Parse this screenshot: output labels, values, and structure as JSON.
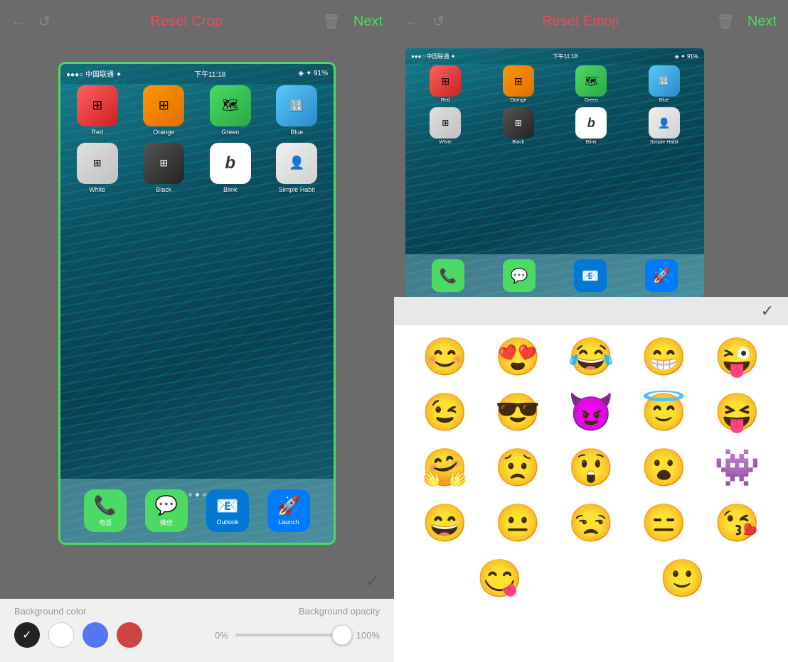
{
  "left": {
    "toolbar": {
      "back_icon": "←",
      "undo_icon": "↺",
      "title": "Reset Crop",
      "trash_icon": "🗑",
      "next_label": "Next"
    },
    "phone": {
      "status_bar": {
        "carrier": "●●●○○ 中国联通 ✦",
        "time": "下午11:18",
        "battery": "⊛ ◈ 91%"
      },
      "apps_row1": [
        {
          "label": "Red",
          "color": "red"
        },
        {
          "label": "Orange",
          "color": "orange"
        },
        {
          "label": "Green",
          "color": "green"
        },
        {
          "label": "Blue",
          "color": "blue"
        }
      ],
      "apps_row2": [
        {
          "label": "White",
          "color": "white"
        },
        {
          "label": "Black",
          "color": "black"
        },
        {
          "label": "Blink",
          "color": "blink"
        },
        {
          "label": "Simple Habit",
          "color": "habit"
        }
      ],
      "dock": [
        {
          "label": "电话",
          "color": "phone",
          "icon": "📞"
        },
        {
          "label": "微信",
          "color": "wechat",
          "icon": "💬"
        },
        {
          "label": "Outlook",
          "color": "outlook",
          "icon": "📧"
        },
        {
          "label": "Launch",
          "color": "launch",
          "icon": "🚀"
        }
      ]
    },
    "bottom": {
      "bg_color_label": "Background color",
      "bg_opacity_label": "Background opacity",
      "opacity_start": "0%",
      "opacity_end": "100%"
    }
  },
  "right": {
    "toolbar": {
      "back_icon": "←",
      "undo_icon": "↺",
      "title": "Reset Emoji",
      "trash_icon": "🗑",
      "next_label": "Next"
    },
    "emojis": [
      [
        "😊",
        "😍",
        "😂",
        "😁",
        "😜"
      ],
      [
        "😉",
        "😎",
        "😈",
        "😇",
        "😝"
      ],
      [
        "🤗",
        "😟",
        "😲",
        "😮",
        "👾"
      ],
      [
        "😄",
        "😐",
        "😒",
        "😑",
        "😘"
      ]
    ]
  }
}
